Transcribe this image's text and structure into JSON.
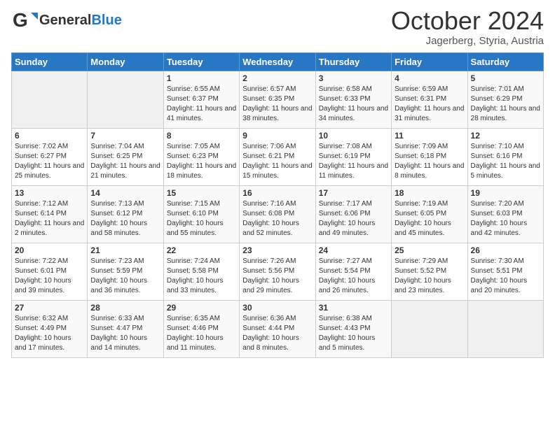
{
  "header": {
    "logo_general": "General",
    "logo_blue": "Blue",
    "month_title": "October 2024",
    "subtitle": "Jagerberg, Styria, Austria"
  },
  "days_of_week": [
    "Sunday",
    "Monday",
    "Tuesday",
    "Wednesday",
    "Thursday",
    "Friday",
    "Saturday"
  ],
  "weeks": [
    [
      {
        "day": "",
        "info": ""
      },
      {
        "day": "",
        "info": ""
      },
      {
        "day": "1",
        "info": "Sunrise: 6:55 AM\nSunset: 6:37 PM\nDaylight: 11 hours and 41 minutes."
      },
      {
        "day": "2",
        "info": "Sunrise: 6:57 AM\nSunset: 6:35 PM\nDaylight: 11 hours and 38 minutes."
      },
      {
        "day": "3",
        "info": "Sunrise: 6:58 AM\nSunset: 6:33 PM\nDaylight: 11 hours and 34 minutes."
      },
      {
        "day": "4",
        "info": "Sunrise: 6:59 AM\nSunset: 6:31 PM\nDaylight: 11 hours and 31 minutes."
      },
      {
        "day": "5",
        "info": "Sunrise: 7:01 AM\nSunset: 6:29 PM\nDaylight: 11 hours and 28 minutes."
      }
    ],
    [
      {
        "day": "6",
        "info": "Sunrise: 7:02 AM\nSunset: 6:27 PM\nDaylight: 11 hours and 25 minutes."
      },
      {
        "day": "7",
        "info": "Sunrise: 7:04 AM\nSunset: 6:25 PM\nDaylight: 11 hours and 21 minutes."
      },
      {
        "day": "8",
        "info": "Sunrise: 7:05 AM\nSunset: 6:23 PM\nDaylight: 11 hours and 18 minutes."
      },
      {
        "day": "9",
        "info": "Sunrise: 7:06 AM\nSunset: 6:21 PM\nDaylight: 11 hours and 15 minutes."
      },
      {
        "day": "10",
        "info": "Sunrise: 7:08 AM\nSunset: 6:19 PM\nDaylight: 11 hours and 11 minutes."
      },
      {
        "day": "11",
        "info": "Sunrise: 7:09 AM\nSunset: 6:18 PM\nDaylight: 11 hours and 8 minutes."
      },
      {
        "day": "12",
        "info": "Sunrise: 7:10 AM\nSunset: 6:16 PM\nDaylight: 11 hours and 5 minutes."
      }
    ],
    [
      {
        "day": "13",
        "info": "Sunrise: 7:12 AM\nSunset: 6:14 PM\nDaylight: 11 hours and 2 minutes."
      },
      {
        "day": "14",
        "info": "Sunrise: 7:13 AM\nSunset: 6:12 PM\nDaylight: 10 hours and 58 minutes."
      },
      {
        "day": "15",
        "info": "Sunrise: 7:15 AM\nSunset: 6:10 PM\nDaylight: 10 hours and 55 minutes."
      },
      {
        "day": "16",
        "info": "Sunrise: 7:16 AM\nSunset: 6:08 PM\nDaylight: 10 hours and 52 minutes."
      },
      {
        "day": "17",
        "info": "Sunrise: 7:17 AM\nSunset: 6:06 PM\nDaylight: 10 hours and 49 minutes."
      },
      {
        "day": "18",
        "info": "Sunrise: 7:19 AM\nSunset: 6:05 PM\nDaylight: 10 hours and 45 minutes."
      },
      {
        "day": "19",
        "info": "Sunrise: 7:20 AM\nSunset: 6:03 PM\nDaylight: 10 hours and 42 minutes."
      }
    ],
    [
      {
        "day": "20",
        "info": "Sunrise: 7:22 AM\nSunset: 6:01 PM\nDaylight: 10 hours and 39 minutes."
      },
      {
        "day": "21",
        "info": "Sunrise: 7:23 AM\nSunset: 5:59 PM\nDaylight: 10 hours and 36 minutes."
      },
      {
        "day": "22",
        "info": "Sunrise: 7:24 AM\nSunset: 5:58 PM\nDaylight: 10 hours and 33 minutes."
      },
      {
        "day": "23",
        "info": "Sunrise: 7:26 AM\nSunset: 5:56 PM\nDaylight: 10 hours and 29 minutes."
      },
      {
        "day": "24",
        "info": "Sunrise: 7:27 AM\nSunset: 5:54 PM\nDaylight: 10 hours and 26 minutes."
      },
      {
        "day": "25",
        "info": "Sunrise: 7:29 AM\nSunset: 5:52 PM\nDaylight: 10 hours and 23 minutes."
      },
      {
        "day": "26",
        "info": "Sunrise: 7:30 AM\nSunset: 5:51 PM\nDaylight: 10 hours and 20 minutes."
      }
    ],
    [
      {
        "day": "27",
        "info": "Sunrise: 6:32 AM\nSunset: 4:49 PM\nDaylight: 10 hours and 17 minutes."
      },
      {
        "day": "28",
        "info": "Sunrise: 6:33 AM\nSunset: 4:47 PM\nDaylight: 10 hours and 14 minutes."
      },
      {
        "day": "29",
        "info": "Sunrise: 6:35 AM\nSunset: 4:46 PM\nDaylight: 10 hours and 11 minutes."
      },
      {
        "day": "30",
        "info": "Sunrise: 6:36 AM\nSunset: 4:44 PM\nDaylight: 10 hours and 8 minutes."
      },
      {
        "day": "31",
        "info": "Sunrise: 6:38 AM\nSunset: 4:43 PM\nDaylight: 10 hours and 5 minutes."
      },
      {
        "day": "",
        "info": ""
      },
      {
        "day": "",
        "info": ""
      }
    ]
  ]
}
